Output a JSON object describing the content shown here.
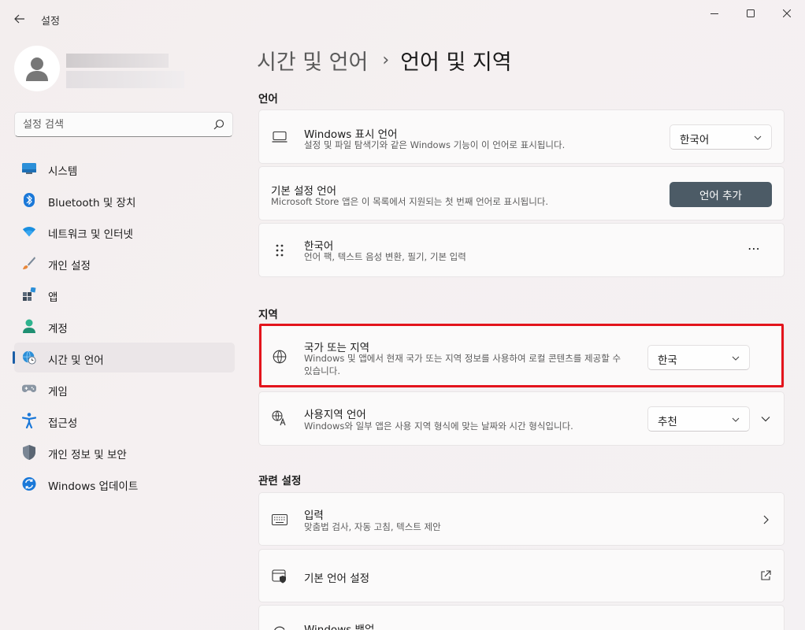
{
  "window": {
    "title": "설정",
    "controls": {
      "minimize": "minimize",
      "maximize": "maximize",
      "close": "close"
    }
  },
  "search": {
    "placeholder": "설정 검색"
  },
  "nav": {
    "items": [
      {
        "label": "시스템",
        "icon": "system-icon"
      },
      {
        "label": "Bluetooth 및 장치",
        "icon": "bluetooth-icon"
      },
      {
        "label": "네트워크 및 인터넷",
        "icon": "wifi-icon"
      },
      {
        "label": "개인 설정",
        "icon": "brush-icon"
      },
      {
        "label": "앱",
        "icon": "apps-icon"
      },
      {
        "label": "계정",
        "icon": "account-icon"
      },
      {
        "label": "시간 및 언어",
        "icon": "time-language-icon",
        "active": true
      },
      {
        "label": "게임",
        "icon": "gamepad-icon"
      },
      {
        "label": "접근성",
        "icon": "accessibility-icon"
      },
      {
        "label": "개인 정보 및 보안",
        "icon": "shield-icon"
      },
      {
        "label": "Windows 업데이트",
        "icon": "update-icon"
      }
    ]
  },
  "breadcrumb": {
    "parent": "시간 및 언어",
    "separator": "›",
    "current": "언어 및 지역"
  },
  "sections": {
    "language": "언어",
    "region": "지역",
    "related": "관련 설정"
  },
  "cards": {
    "display_language": {
      "title": "Windows 표시 언어",
      "desc": "설정 및 파일 탐색기와 같은 Windows 기능이 이 언어로 표시됩니다.",
      "value": "한국어"
    },
    "preferred_language": {
      "title": "기본 설정 언어",
      "desc": "Microsoft Store 앱은 이 목록에서 지원되는 첫 번째 언어로 표시됩니다.",
      "button": "언어 추가"
    },
    "korean": {
      "title": "한국어",
      "desc": "언어 팩, 텍스트 음성 변환, 필기, 기본 입력",
      "more": "⋯"
    },
    "country": {
      "title": "국가 또는 지역",
      "desc": "Windows 및 앱에서 현재 국가 또는 지역 정보를 사용하여 로컬 콘텐츠를 제공할 수 있습니다.",
      "value": "한국"
    },
    "regional_format": {
      "title": "사용지역 언어",
      "desc": "Windows와 일부 앱은 사용 지역 형식에 맞는 날짜와 시간 형식입니다.",
      "value": "추천"
    },
    "typing": {
      "title": "입력",
      "desc": "맞춤법 검사, 자동 고침, 텍스트 제안"
    },
    "admin_language": {
      "title": "기본 언어 설정"
    },
    "backup": {
      "title": "Windows 백업"
    }
  },
  "colors": {
    "accent": "#1a5ea7",
    "highlight": "#e3141c",
    "button": "#4c5b66"
  }
}
